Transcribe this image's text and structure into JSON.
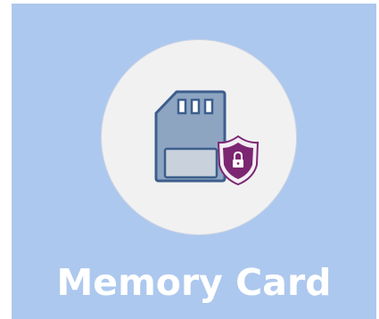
{
  "tile": {
    "label": "Memory Card",
    "icon": "memory-card-lock-icon",
    "background_color": "#adc8ee",
    "circle_color": "#f1f1f2",
    "card_color": "#8da5c1",
    "card_outline_color": "#3d5e8d",
    "shield_color": "#7c2671"
  }
}
